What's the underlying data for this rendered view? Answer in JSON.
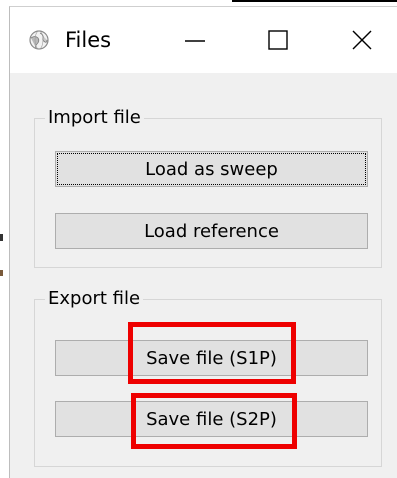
{
  "window": {
    "title": "Files",
    "icon": "app-globe-icon"
  },
  "title_buttons": [
    "minimize-icon",
    "maximize-icon",
    "close-icon"
  ],
  "import_group": {
    "title": "Import file",
    "buttons": {
      "load_sweep": "Load as sweep",
      "load_reference": "Load reference"
    }
  },
  "export_group": {
    "title": "Export file",
    "buttons": {
      "save_s1p": "Save file (S1P)",
      "save_s2p": "Save file (S2P)"
    }
  },
  "colors": {
    "highlight": "#ee0000",
    "dialog_background": "#f0f0f0",
    "button_face": "#e1e1e1"
  }
}
